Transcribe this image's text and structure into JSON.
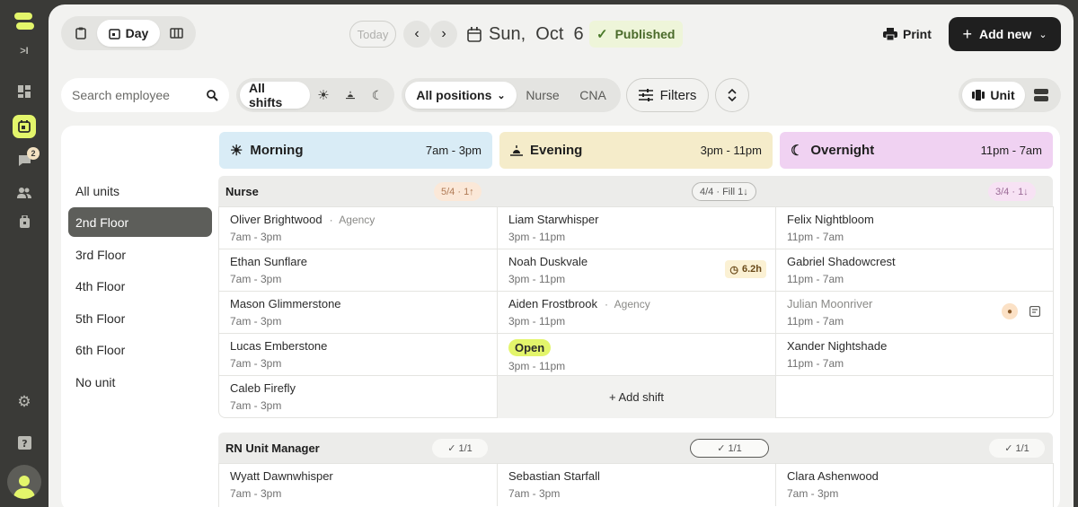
{
  "nav": {
    "expand_label": ">I",
    "badge_count": "2"
  },
  "toolbar": {
    "view_day_label": "Day",
    "today_label": "Today",
    "date_label": "Sun,  Oct  6",
    "published_label": "Published",
    "print_label": "Print",
    "add_new_label": "Add new"
  },
  "filters": {
    "search_placeholder": "Search employee",
    "all_shifts_label": "All shifts",
    "all_positions_label": "All positions",
    "position_options": [
      "Nurse",
      "CNA"
    ],
    "filters_label": "Filters",
    "unit_view_label": "Unit"
  },
  "units": [
    "All units",
    "2nd Floor",
    "3rd Floor",
    "4th Floor",
    "5th Floor",
    "6th Floor",
    "No unit"
  ],
  "shifts": [
    {
      "name": "Morning",
      "time": "7am - 3pm",
      "color": "#d9ecf6"
    },
    {
      "name": "Evening",
      "time": "3pm - 11pm",
      "color": "#f5ecca"
    },
    {
      "name": "Overnight",
      "time": "11pm - 7am",
      "color": "#f0d2f2"
    }
  ],
  "sections": [
    {
      "title": "Nurse",
      "stats": [
        "5/4 · 1↑",
        "4/4 · Fill 1↓",
        "3/4 · 1↓"
      ],
      "rows": [
        [
          {
            "name": "Oliver Brightwood",
            "tag": "Agency",
            "time": "7am - 3pm"
          },
          {
            "name": "Liam Starwhisper",
            "time": "3pm - 11pm"
          },
          {
            "name": "Felix Nightbloom",
            "time": "11pm - 7am"
          }
        ],
        [
          {
            "name": "Ethan Sunflare",
            "time": "7am - 3pm"
          },
          {
            "name": "Noah Duskvale",
            "time": "3pm - 11pm",
            "hours": "6.2h"
          },
          {
            "name": "Gabriel Shadowcrest",
            "time": "11pm - 7am"
          }
        ],
        [
          {
            "name": "Mason Glimmerstone",
            "time": "7am - 3pm"
          },
          {
            "name": "Aiden Frostbrook",
            "tag": "Agency",
            "time": "3pm - 11pm"
          },
          {
            "name": "Julian Moonriver",
            "time": "11pm - 7am"
          }
        ],
        [
          {
            "name": "Lucas Emberstone",
            "time": "7am - 3pm"
          },
          {
            "name": "Open",
            "time": "3pm - 11pm"
          },
          {
            "name": "Xander Nightshade",
            "time": "11pm - 7am"
          }
        ],
        [
          {
            "name": "Caleb Firefly",
            "time": "7am - 3pm"
          },
          {
            "name": "+ Add shift"
          },
          {
            "name": ""
          }
        ]
      ]
    },
    {
      "title": "RN Unit Manager",
      "stats": [
        "✓ 1/1",
        "✓ 1/1",
        "✓ 1/1"
      ],
      "rows": [
        [
          {
            "name": "Wyatt Dawnwhisper",
            "time": "7am - 3pm"
          },
          {
            "name": "Sebastian Starfall",
            "time": "7am - 3pm"
          },
          {
            "name": "Clara Ashenwood",
            "time": "7am - 3pm"
          }
        ]
      ]
    }
  ]
}
